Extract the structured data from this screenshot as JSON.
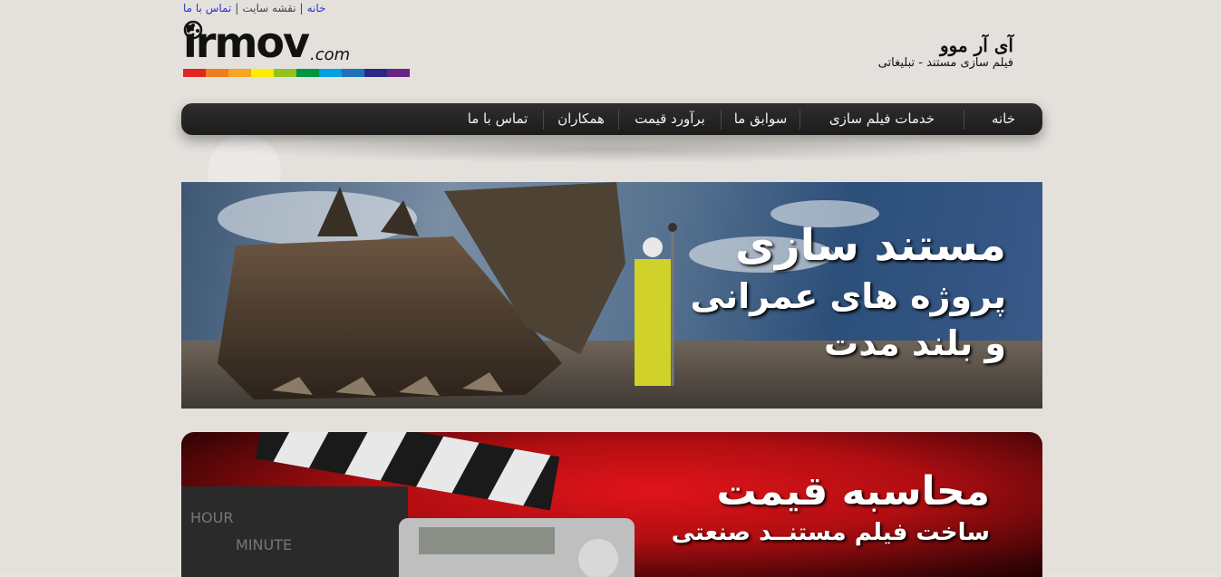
{
  "toplinks": {
    "home": "خانه",
    "sitemap": "نقشه سایت",
    "contact": "تماس با ما",
    "separator": "|"
  },
  "logo": {
    "main": "irmov",
    "suffix": ".com",
    "rainbow_colors": [
      "#e52421",
      "#ef7d1f",
      "#f6a623",
      "#ffec00",
      "#95c11f",
      "#009640",
      "#00a0e3",
      "#1d71b8",
      "#2a2a86",
      "#662483"
    ]
  },
  "brand": {
    "title": "آی آر موو",
    "subtitle": "فیلم سازی مستند - تبلیغاتی"
  },
  "nav": {
    "items": [
      {
        "label": "خانه",
        "width": 86
      },
      {
        "label": "خدمات فیلم سازی",
        "width": 180
      },
      {
        "label": "سوابق ما",
        "width": 86
      },
      {
        "label": "برآورد قیمت",
        "width": 112
      },
      {
        "label": "همکاران",
        "width": 82
      },
      {
        "label": "تماس با ما",
        "width": 100
      }
    ]
  },
  "banner1": {
    "line1": "مستند سازی",
    "line2": "پروژه های عمرانی",
    "line3": "و بلند مدت"
  },
  "banner2": {
    "line1": "محاسبه قیمت",
    "line2": "ساخت فیلم مستنــد صنعتی"
  },
  "colors": {
    "link": "#2a37c8",
    "nav_bg": "#262626",
    "page_bg": "#e4e0dc"
  }
}
